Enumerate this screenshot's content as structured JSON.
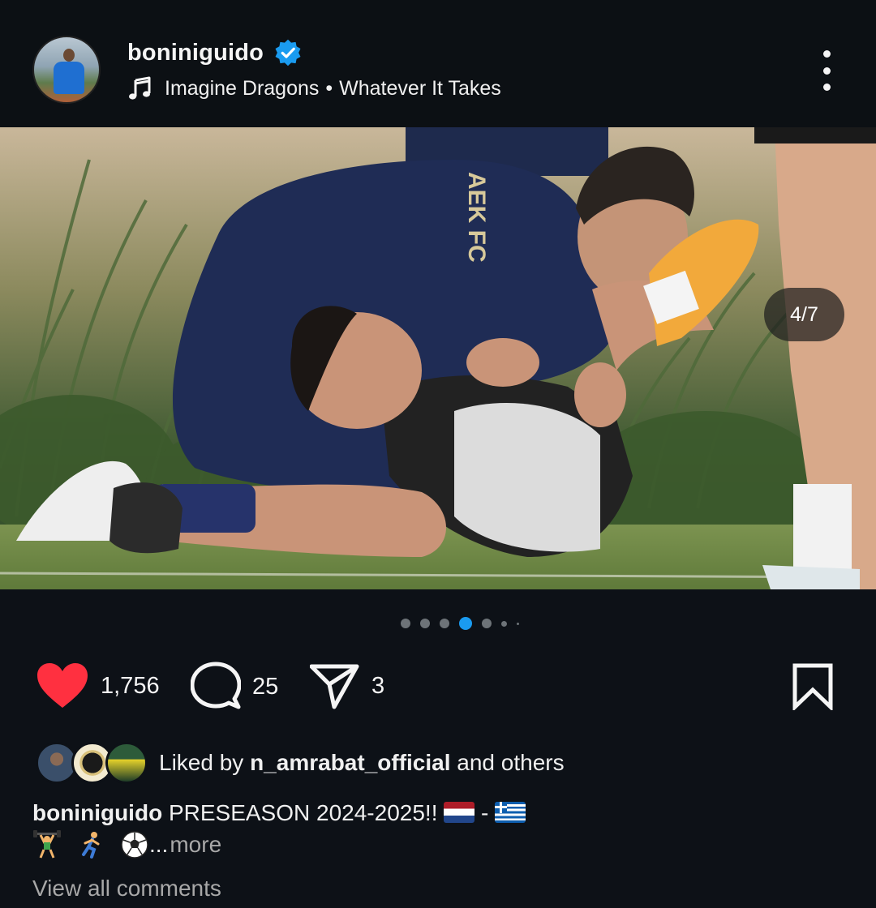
{
  "post": {
    "username": "boniniguido",
    "verified": true,
    "music": {
      "icon": "music-note-icon",
      "artist": "Imagine Dragons",
      "separator": "•",
      "song": "Whatever It Takes"
    },
    "more_icon": "more-vertical-icon"
  },
  "media": {
    "counter": "4/7",
    "jersey_text": "AEK FC",
    "carousel_total_dots": 7,
    "active_index": 4
  },
  "actions": {
    "likes": "1,756",
    "comments": "25",
    "shares": "3"
  },
  "liked_by": {
    "prefix": "Liked by",
    "user": "n_amrabat_official",
    "suffix": "and others"
  },
  "caption": {
    "username": "boniniguido",
    "text": "PRESEASON 2024-2025!!",
    "dash": "-",
    "ellipsis": "...",
    "more": "more"
  },
  "comments_link": "View all comments",
  "colors": {
    "background": "#0d1117",
    "verified": "#1a9bf0",
    "like": "#ff3040",
    "active_dot": "#1a9bf0"
  }
}
